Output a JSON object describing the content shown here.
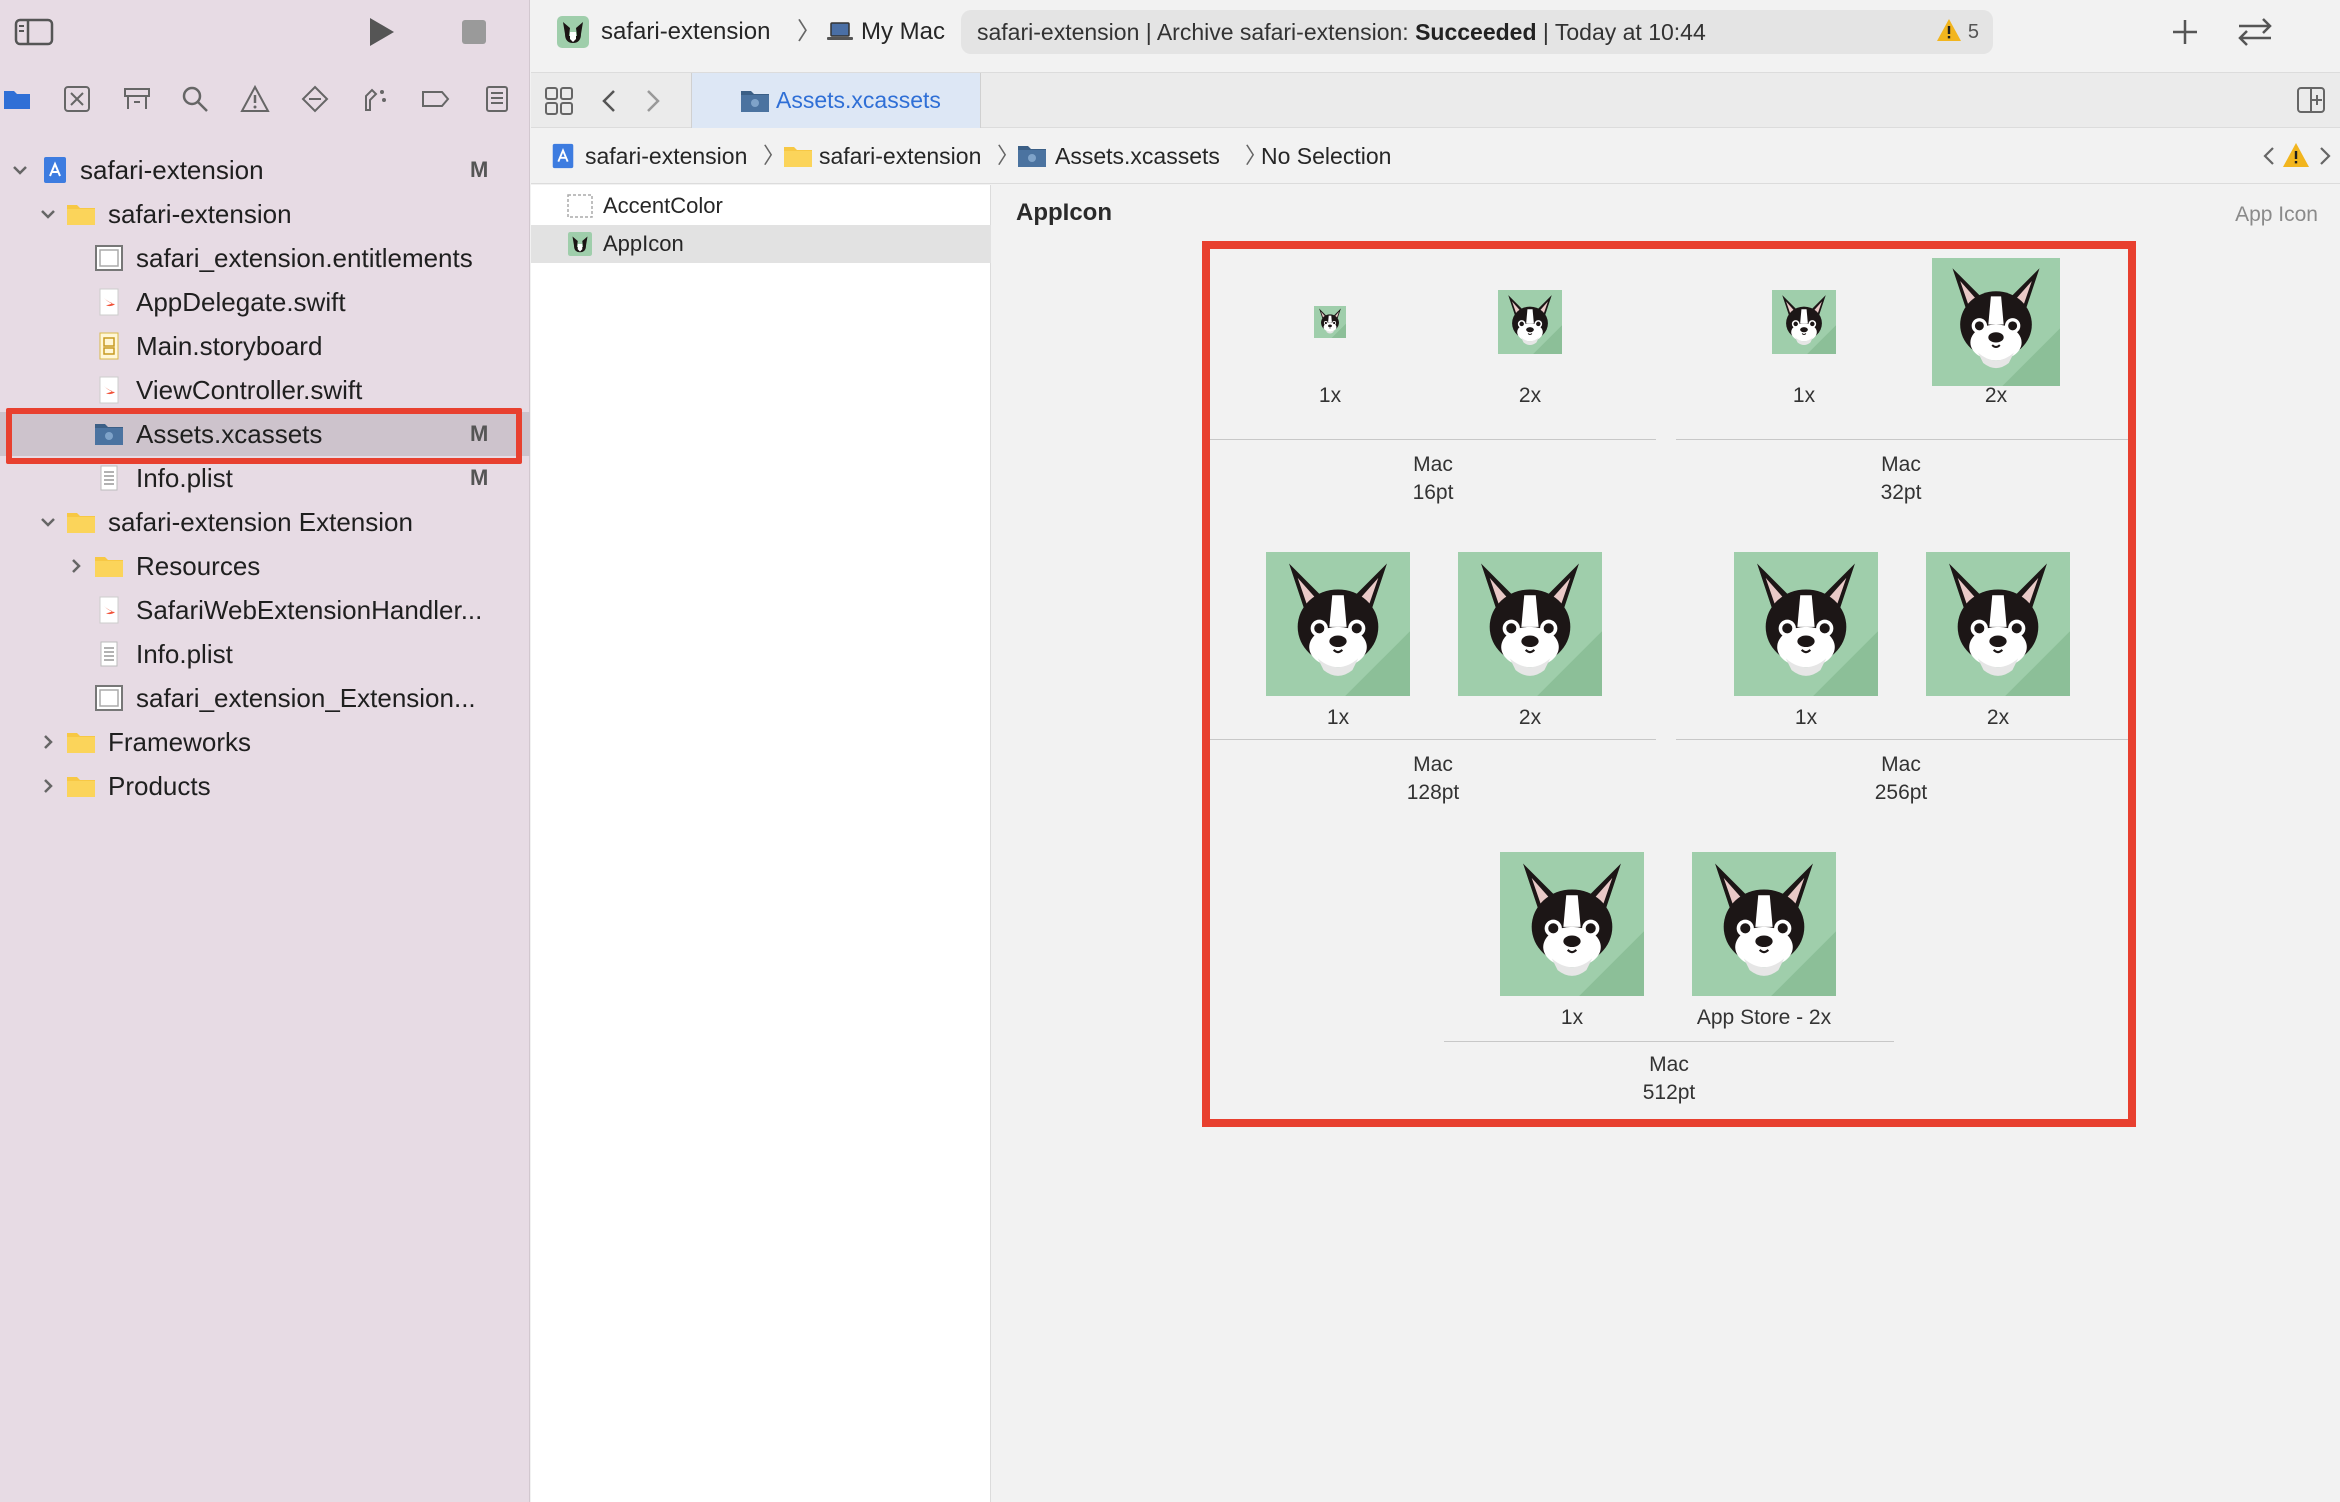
{
  "toolbar": {
    "scheme_name": "safari-extension",
    "destination": "My Mac",
    "status_prefix": "safari-extension | Archive safari-extension: ",
    "status_result": "Succeeded",
    "status_suffix": " | Today at 10:44",
    "warning_count": "5"
  },
  "tab": {
    "label": "Assets.xcassets"
  },
  "jumpbar": {
    "crumbs": [
      "safari-extension",
      "safari-extension",
      "Assets.xcassets",
      "No Selection"
    ]
  },
  "navigator": {
    "rows": [
      {
        "label": "safari-extension",
        "badge": "M",
        "icon": "project-icon"
      },
      {
        "label": "safari-extension",
        "badge": "",
        "icon": "folder-icon"
      },
      {
        "label": "safari_extension.entitlements",
        "badge": "",
        "icon": "entitlements-file-icon"
      },
      {
        "label": "AppDelegate.swift",
        "badge": "",
        "icon": "swift-file-icon"
      },
      {
        "label": "Main.storyboard",
        "badge": "",
        "icon": "storyboard-file-icon"
      },
      {
        "label": "ViewController.swift",
        "badge": "",
        "icon": "swift-file-icon"
      },
      {
        "label": "Assets.xcassets",
        "badge": "M",
        "icon": "asset-catalog-icon"
      },
      {
        "label": "Info.plist",
        "badge": "M",
        "icon": "plist-file-icon"
      },
      {
        "label": "safari-extension Extension",
        "badge": "",
        "icon": "folder-icon"
      },
      {
        "label": "Resources",
        "badge": "",
        "icon": "folder-icon"
      },
      {
        "label": "SafariWebExtensionHandler...",
        "badge": "",
        "icon": "swift-file-icon"
      },
      {
        "label": "Info.plist",
        "badge": "",
        "icon": "plist-file-icon"
      },
      {
        "label": "safari_extension_Extension...",
        "badge": "",
        "icon": "entitlements-file-icon"
      },
      {
        "label": "Frameworks",
        "badge": "",
        "icon": "folder-icon"
      },
      {
        "label": "Products",
        "badge": "",
        "icon": "folder-icon"
      }
    ]
  },
  "assets": {
    "items": [
      "AccentColor",
      "AppIcon"
    ]
  },
  "editor": {
    "title": "AppIcon",
    "kind": "App Icon",
    "groups": [
      {
        "platform": "Mac",
        "size": "16pt",
        "captions": [
          "1x",
          "2x"
        ]
      },
      {
        "platform": "Mac",
        "size": "32pt",
        "captions": [
          "1x",
          "2x"
        ]
      },
      {
        "platform": "Mac",
        "size": "128pt",
        "captions": [
          "1x",
          "2x"
        ]
      },
      {
        "platform": "Mac",
        "size": "256pt",
        "captions": [
          "1x",
          "2x"
        ]
      },
      {
        "platform": "Mac",
        "size": "512pt",
        "captions": [
          "1x",
          "App Store - 2x"
        ]
      }
    ]
  },
  "colors": {
    "sidebar_bg": "#e7dbe4",
    "highlight": "#e8402f",
    "accent": "#2f6fd6",
    "icon_bg": "#9fceab"
  }
}
